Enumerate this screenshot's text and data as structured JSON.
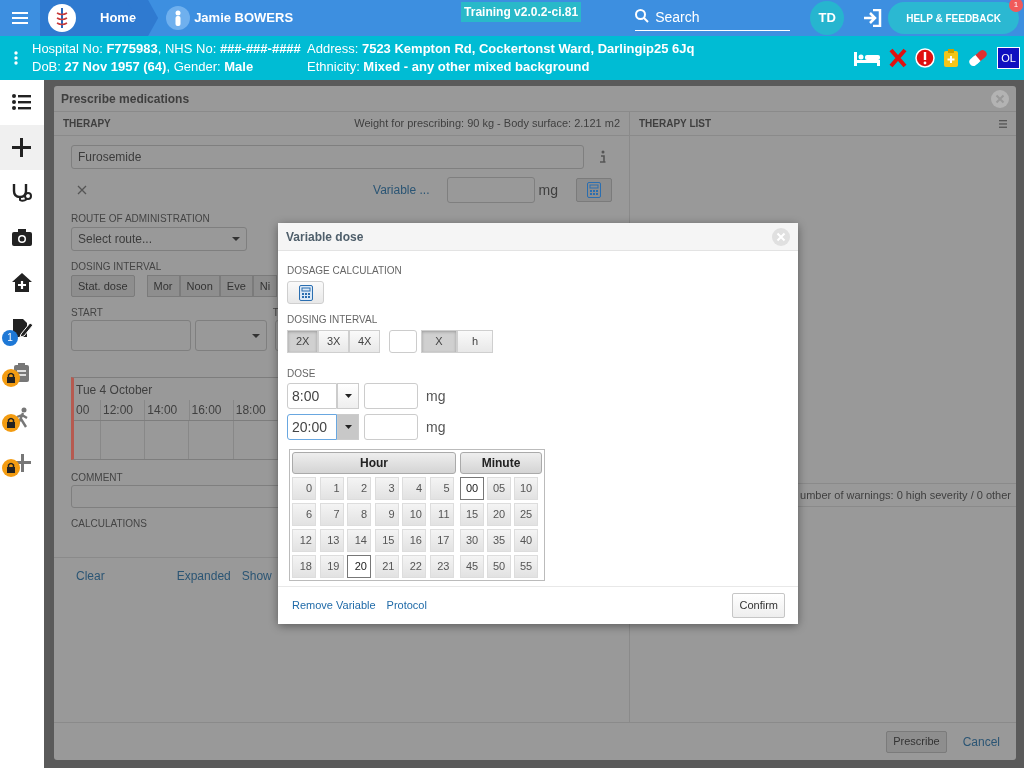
{
  "top_bar": {
    "home": "Home",
    "patient_name": "Jamie BOWERS",
    "version": "Training v2.0.2-ci.81",
    "search": {
      "placeholder": "Search"
    },
    "user_initials": "TD",
    "help_button": "HELP & FEEDBACK",
    "help_badge": "1"
  },
  "patient_banner": {
    "left_lines": [
      "Hospital No: **F775983**, NHS No: **###-###-####**",
      "DoB: **27 Nov 1957 (64)**, Gender: **Male**"
    ],
    "right_lines": [
      "Address: **7523 Kempton Rd, Cockertonst Ward, Darlingip25 6Jq**",
      "Ethnicity: **Mixed - any other mixed background**"
    ],
    "alert_code": "OL"
  },
  "sidebar": {
    "items": [
      {
        "kind": "list",
        "selected": false,
        "locked": false
      },
      {
        "kind": "plus",
        "selected": true,
        "locked": false
      },
      {
        "kind": "stethoscope",
        "selected": false,
        "locked": false
      },
      {
        "kind": "camera",
        "selected": false,
        "locked": false
      },
      {
        "kind": "house",
        "selected": false,
        "locked": false
      },
      {
        "kind": "edit",
        "selected": false,
        "locked": false,
        "badge": "1"
      },
      {
        "kind": "clipboard",
        "selected": false,
        "locked": true
      },
      {
        "kind": "walker",
        "selected": false,
        "locked": true
      },
      {
        "kind": "add",
        "selected": false,
        "locked": true
      }
    ]
  },
  "prescribe_dialog": {
    "title": "Prescribe medications",
    "therapy": {
      "heading": "THERAPY",
      "weight_info": "Weight for prescribing: 90 kg - Body surface: 2.121 m2",
      "medication": "Furosemide",
      "variable_link": "Variable ...",
      "dose_unit": "mg",
      "route_label": "ROUTE OF ADMINISTRATION",
      "route_placeholder": "Select route...",
      "dosing_interval_label": "DOSING INTERVAL",
      "stat_dose": "Stat. dose",
      "interval_buttons": [
        "Mor",
        "Noon",
        "Eve",
        "Ni"
      ],
      "start_label": "START",
      "column_3_label": "T",
      "timeline": {
        "date": "Tue 4 October",
        "hours": [
          "00",
          "12:00",
          "14:00",
          "16:00",
          "18:00"
        ]
      },
      "comment_label": "COMMENT",
      "calculations_label": "CALCULATIONS",
      "footer_links": [
        "Clear",
        "Expanded",
        "Show"
      ]
    },
    "therapy_list": {
      "heading": "THERAPY LIST",
      "warnings": "umber of warnings: 0 high severity / 0 other"
    },
    "prescribe_button": "Prescribe",
    "cancel_link": "Cancel"
  },
  "variable_dose": {
    "title": "Variable dose",
    "dosage_calculation_label": "DOSAGE CALCULATION",
    "dosing_interval_label": "DOSING INTERVAL",
    "frequency": [
      {
        "label": "2X",
        "selected": true
      },
      {
        "label": "3X",
        "selected": false
      },
      {
        "label": "4X",
        "selected": false
      }
    ],
    "interval_mode": [
      {
        "label": "X",
        "selected": true
      },
      {
        "label": "h",
        "selected": false
      }
    ],
    "dose_label": "DOSE",
    "doses": [
      {
        "time": "8:00",
        "unit": "mg",
        "focused": false
      },
      {
        "time": "20:00",
        "unit": "mg",
        "focused": true
      }
    ],
    "time_picker": {
      "hour_heading": "Hour",
      "minute_heading": "Minute",
      "hours": [
        {
          "label": "0",
          "selected": false
        },
        {
          "label": "1",
          "selected": false
        },
        {
          "label": "2",
          "selected": false
        },
        {
          "label": "3",
          "selected": false
        },
        {
          "label": "4",
          "selected": false
        },
        {
          "label": "5",
          "selected": false
        },
        {
          "label": "6",
          "selected": false
        },
        {
          "label": "7",
          "selected": false
        },
        {
          "label": "8",
          "selected": false
        },
        {
          "label": "9",
          "selected": false
        },
        {
          "label": "10",
          "selected": false
        },
        {
          "label": "11",
          "selected": false
        },
        {
          "label": "12",
          "selected": false
        },
        {
          "label": "13",
          "selected": false
        },
        {
          "label": "14",
          "selected": false
        },
        {
          "label": "15",
          "selected": false
        },
        {
          "label": "16",
          "selected": false
        },
        {
          "label": "17",
          "selected": false
        },
        {
          "label": "18",
          "selected": false
        },
        {
          "label": "19",
          "selected": false
        },
        {
          "label": "20",
          "selected": true
        },
        {
          "label": "21",
          "selected": false
        },
        {
          "label": "22",
          "selected": false
        },
        {
          "label": "23",
          "selected": false
        }
      ],
      "minutes": [
        {
          "label": "00",
          "selected": true
        },
        {
          "label": "05",
          "selected": false
        },
        {
          "label": "10",
          "selected": false
        },
        {
          "label": "15",
          "selected": false
        },
        {
          "label": "20",
          "selected": false
        },
        {
          "label": "25",
          "selected": false
        },
        {
          "label": "30",
          "selected": false
        },
        {
          "label": "35",
          "selected": false
        },
        {
          "label": "40",
          "selected": false
        },
        {
          "label": "45",
          "selected": false
        },
        {
          "label": "50",
          "selected": false
        },
        {
          "label": "55",
          "selected": false
        }
      ]
    },
    "links": [
      "Remove Variable",
      "Protocol"
    ],
    "confirm_button": "Confirm"
  }
}
